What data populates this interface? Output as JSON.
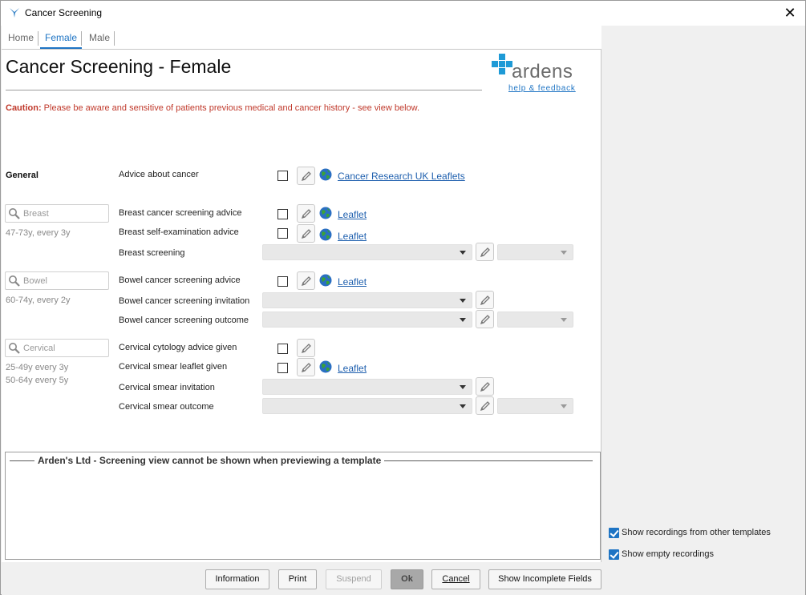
{
  "window": {
    "title": "Cancer Screening",
    "close_glyph": "✕"
  },
  "tabs": [
    {
      "label": "Home"
    },
    {
      "label": "Female"
    },
    {
      "label": "Male"
    }
  ],
  "active_tab": "Female",
  "header": {
    "page_title": "Cancer Screening - Female",
    "logo_text": "ardens",
    "help_link": "help & feedback"
  },
  "caution": {
    "label": "Caution:",
    "text": " Please be aware and sensitive of patients previous medical and cancer history - see view below."
  },
  "general": {
    "heading": "General",
    "advice_label": "Advice about cancer",
    "advice_link": "Cancer Research UK Leaflets"
  },
  "breast": {
    "search_placeholder": "Breast",
    "hint": "47-73y, every 3y",
    "rows": {
      "advice": "Breast cancer screening advice",
      "self_exam": "Breast self-examination advice",
      "screening": "Breast screening"
    },
    "leaflet": "Leaflet"
  },
  "bowel": {
    "search_placeholder": "Bowel",
    "hint": "60-74y, every 2y",
    "rows": {
      "advice": "Bowel cancer screening advice",
      "invitation": "Bowel cancer screening invitation",
      "outcome": "Bowel cancer screening outcome"
    },
    "leaflet": "Leaflet"
  },
  "cervical": {
    "search_placeholder": "Cervical",
    "hint1": "25-49y every 3y",
    "hint2": "50-64y every 5y",
    "rows": {
      "cytology": "Cervical cytology advice given",
      "leaflet_given": "Cervical smear leaflet given",
      "invitation": "Cervical smear invitation",
      "outcome": "Cervical smear outcome"
    },
    "leaflet": "Leaflet"
  },
  "view_panel": {
    "title": "Arden's Ltd - Screening view cannot be shown when previewing a template"
  },
  "options": {
    "show_other_templates": {
      "label": "Show recordings from other templates",
      "checked": true
    },
    "show_empty": {
      "label": "Show empty recordings",
      "checked": true
    }
  },
  "footer": {
    "information": "Information",
    "print": "Print",
    "suspend": "Suspend",
    "ok": "Ok",
    "cancel": "Cancel",
    "show_incomplete": "Show Incomplete Fields"
  },
  "colors": {
    "accent": "#1e74c4",
    "caution": "#c0392b",
    "link": "#1e5fae",
    "logo_cross": "#1e9ad6"
  },
  "icons": [
    "app-icon",
    "close-icon",
    "search-icon",
    "pencil-icon",
    "globe-icon",
    "checkbox-checked-icon"
  ]
}
